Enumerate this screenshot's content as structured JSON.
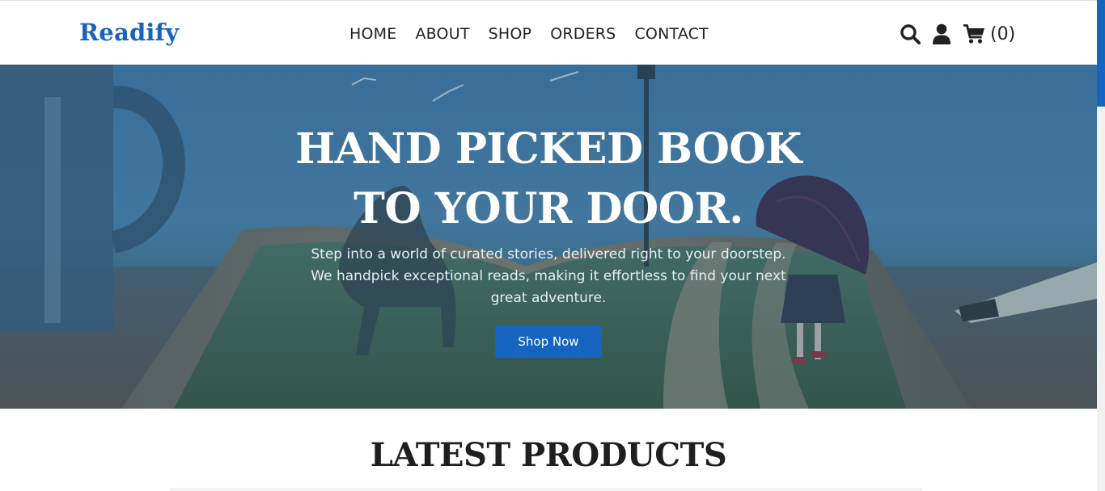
{
  "header": {
    "logo": "Readify",
    "nav": [
      "HOME",
      "ABOUT",
      "SHOP",
      "ORDERS",
      "CONTACT"
    ],
    "icons": [
      "search-icon",
      "user-icon",
      "cart-icon"
    ],
    "cart_count": "(0)"
  },
  "hero": {
    "title_line1": "HAND PICKED BOOK",
    "title_line2": "TO YOUR DOOR.",
    "subtitle": "Step into a world of curated stories, delivered right to your doorstep. We handpick exceptional reads, making it effortless to find your next great adventure.",
    "button_label": "Shop Now"
  },
  "section": {
    "title": "LATEST PRODUCTS"
  },
  "colors": {
    "accent": "#1565c0",
    "hero_overlay": "#2d5f86",
    "text_dark": "#222222"
  }
}
